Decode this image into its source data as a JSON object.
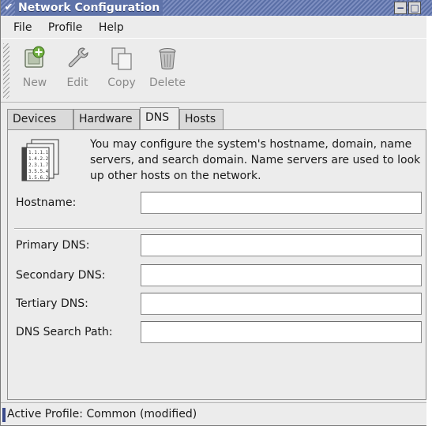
{
  "window": {
    "title": "Network Configuration",
    "controls": {
      "minimize": "−",
      "maximize": "□"
    }
  },
  "menubar": {
    "items": [
      {
        "label": "File"
      },
      {
        "label": "Profile"
      },
      {
        "label": "Help"
      }
    ]
  },
  "toolbar": {
    "buttons": [
      {
        "label": "New",
        "icon": "new-device-icon"
      },
      {
        "label": "Edit",
        "icon": "wrench-icon"
      },
      {
        "label": "Copy",
        "icon": "copy-icon"
      },
      {
        "label": "Delete",
        "icon": "trash-can-icon"
      }
    ]
  },
  "tabs": [
    {
      "label": "Devices",
      "active": false
    },
    {
      "label": "Hardware",
      "active": false
    },
    {
      "label": "DNS",
      "active": true
    },
    {
      "label": "Hosts",
      "active": false
    }
  ],
  "dns_panel": {
    "description": "You may configure the system's hostname, domain, name servers, and search domain. Name servers are used to look up other hosts on the network.",
    "hostname": {
      "label": "Hostname:",
      "value": ""
    },
    "primary_dns": {
      "label": "Primary DNS:",
      "value": ""
    },
    "secondary_dns": {
      "label": "Secondary DNS:",
      "value": ""
    },
    "tertiary_dns": {
      "label": "Tertiary DNS:",
      "value": ""
    },
    "search_path": {
      "label": "DNS Search Path:",
      "value": ""
    },
    "icon_card_lines": [
      "1.1.1.1",
      "1.4.2.2",
      "2.3.1.7",
      "3.5.5.4",
      "1.5.6.2"
    ]
  },
  "statusbar": {
    "text": "Active Profile: Common (modified)"
  },
  "colors": {
    "titlebar": "#5f73a9",
    "window_bg": "#ececec",
    "disabled_text": "#8a8a8a"
  }
}
